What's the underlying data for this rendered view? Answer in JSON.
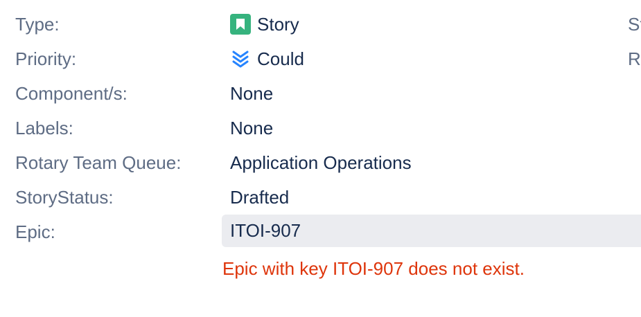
{
  "fields": [
    {
      "label": "Type:",
      "value": "Story",
      "icon": "story-icon"
    },
    {
      "label": "Priority:",
      "value": "Could",
      "icon": "priority-could-icon"
    },
    {
      "label": "Component/s:",
      "value": "None"
    },
    {
      "label": "Labels:",
      "value": "None"
    },
    {
      "label": "Rotary Team Queue:",
      "value": "Application Operations"
    },
    {
      "label": "StoryStatus:",
      "value": "Drafted"
    },
    {
      "label": "Epic:",
      "value": "ITOI-907"
    }
  ],
  "epic": {
    "error": "Epic with key ITOI-907 does not exist."
  },
  "right_column": [
    "St",
    "Re"
  ],
  "colors": {
    "label": "#5e6c84",
    "value": "#172b4d",
    "story_icon": "#36b37e",
    "priority_icon": "#2684ff",
    "error": "#de350b",
    "field_bg": "#ebecf0"
  }
}
